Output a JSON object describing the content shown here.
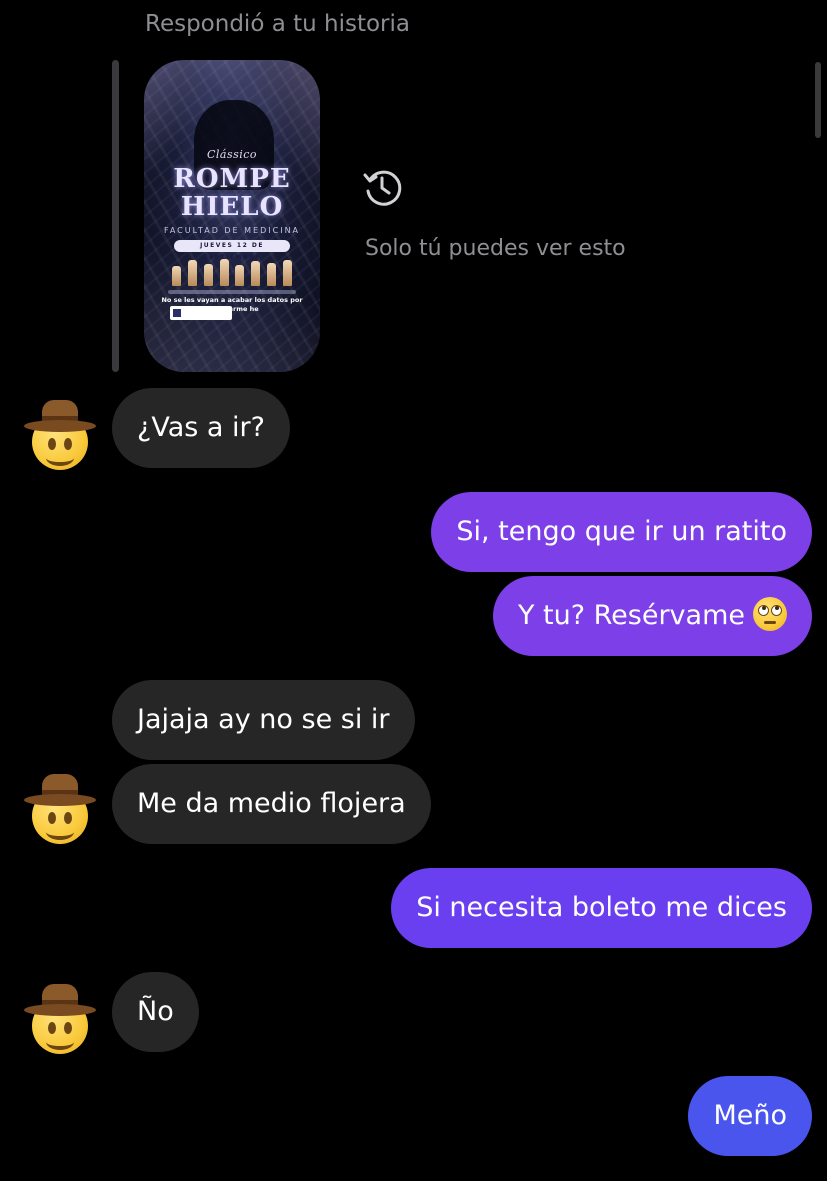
{
  "reply_header": "Respondió a tu historia",
  "story": {
    "brand": "Clássico",
    "title_line1": "ROMPE",
    "title_line2": "HIELO",
    "faculty": "FACULTAD DE MEDICINA",
    "date": "JUEVES 12 DE SEPTIEMBRE",
    "note": "No se les vayan a acabar los datos por reservarme he"
  },
  "history_icon": "history-clock-icon",
  "visibility_note": "Solo tú puedes ver esto",
  "avatar_icon": "cowboy-emoji-avatar",
  "messages": [
    {
      "text": "¿Vas a ir?",
      "direction": "incoming"
    },
    {
      "text": "Si, tengo que ir un ratito",
      "direction": "outgoing"
    },
    {
      "text": "Y tu? Resérvame",
      "direction": "outgoing",
      "emoji": "face-with-rolling-eyes"
    },
    {
      "text": "Jajaja ay no se si ir",
      "direction": "incoming"
    },
    {
      "text": "Me da medio flojera",
      "direction": "incoming"
    },
    {
      "text": "Si necesita boleto me dices",
      "direction": "outgoing"
    },
    {
      "text": "Ño",
      "direction": "incoming"
    },
    {
      "text": "Meño",
      "direction": "outgoing"
    }
  ],
  "colors": {
    "background": "#000000",
    "incoming_bubble": "#262626",
    "outgoing_bubble_top": "#7c3fe8",
    "outgoing_bubble_mid": "#6a3ff0",
    "outgoing_bubble_bottom": "#4a55ee",
    "secondary_text": "#8e8e93"
  }
}
